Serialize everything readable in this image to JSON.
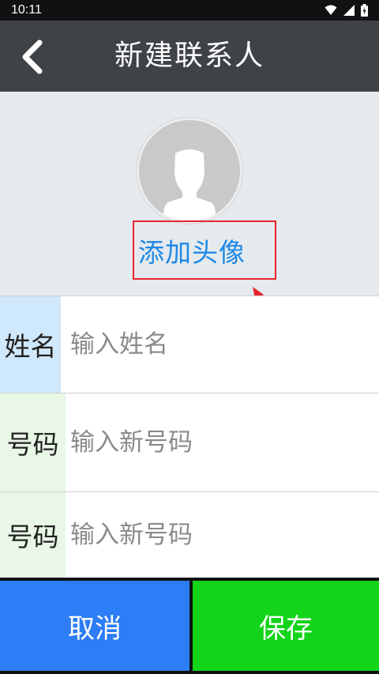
{
  "status_bar": {
    "time": "10:11",
    "icons": [
      "wifi-icon",
      "signal-icon",
      "battery-icon"
    ]
  },
  "header": {
    "title": "新建联系人",
    "back_icon": "chevron-left-icon"
  },
  "avatar": {
    "icon": "person-silhouette-icon",
    "add_label": "添加头像"
  },
  "form": {
    "name": {
      "label": "姓名",
      "placeholder": "输入姓名",
      "value": ""
    },
    "phone1": {
      "label": "号码",
      "placeholder": "输入新号码",
      "value": ""
    },
    "phone2": {
      "label": "号码",
      "placeholder": "输入新号码",
      "value": ""
    }
  },
  "actions": {
    "cancel_label": "取消",
    "save_label": "保存"
  },
  "colors": {
    "header_bg": "#3f4347",
    "avatar_section_bg": "#e4eaee",
    "link_blue": "#1e88e5",
    "annotation_red": "#e8262d",
    "cancel_bg": "#2d7df6",
    "save_bg": "#12d418",
    "name_label_bg": "#cfe8fb",
    "phone_label_bg": "#e8f7e6"
  }
}
